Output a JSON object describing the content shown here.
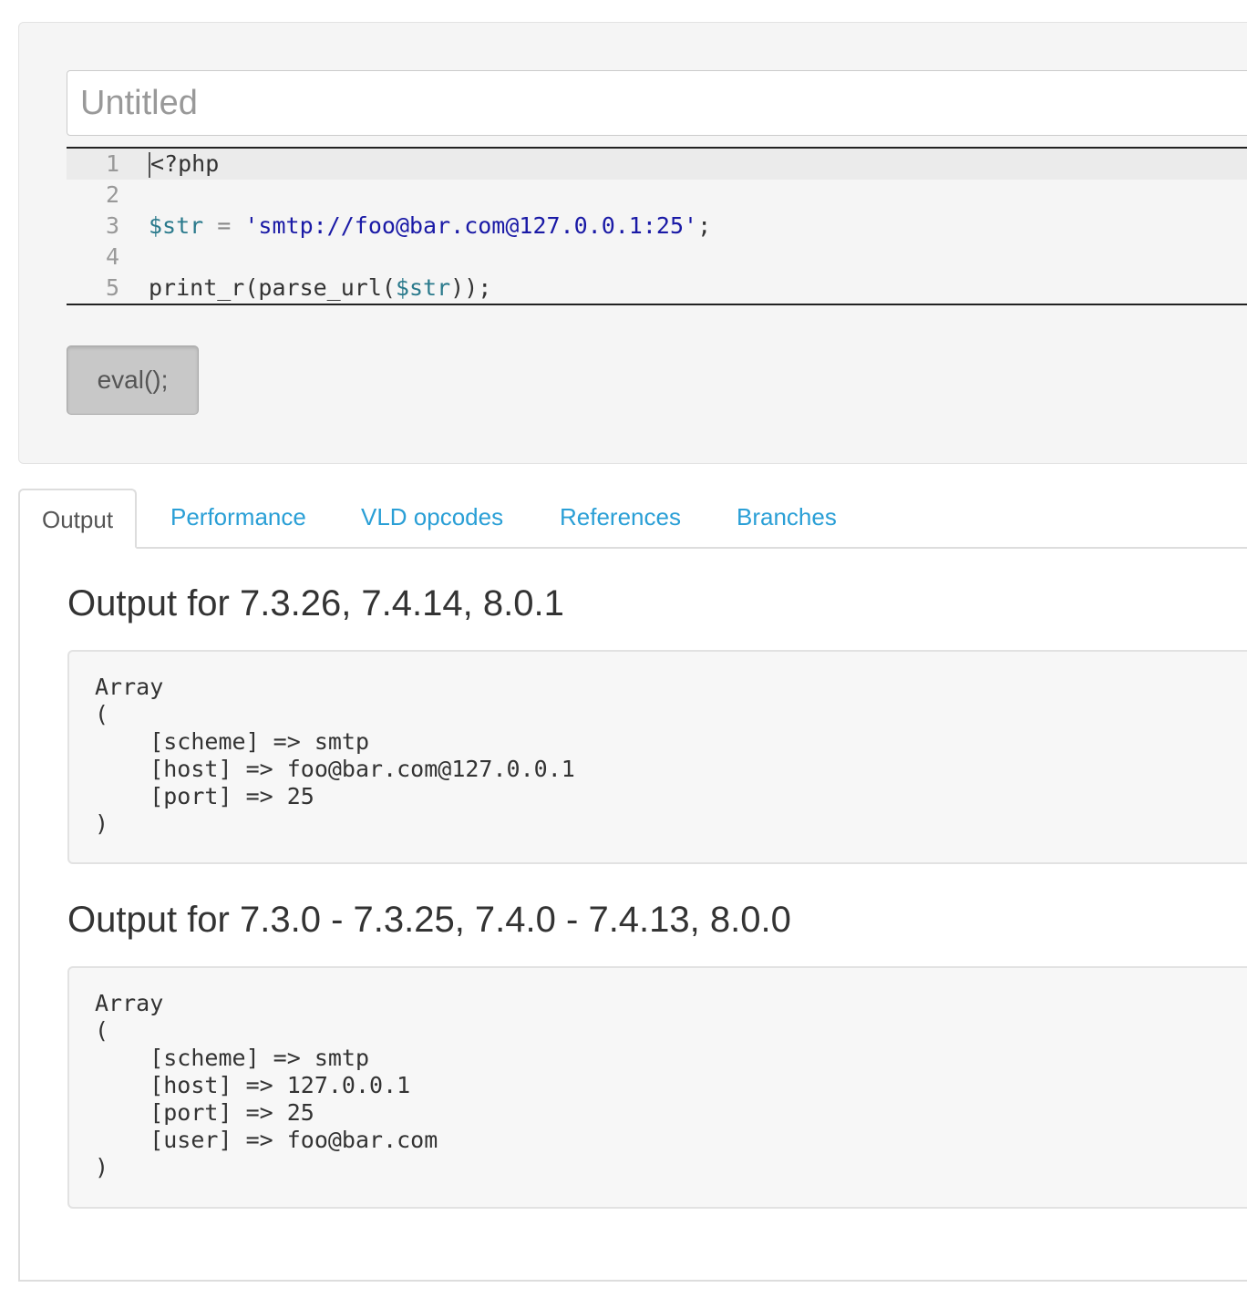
{
  "editor": {
    "title_placeholder": "Untitled",
    "title_value": "",
    "code_lines": [
      {
        "num": "1"
      },
      {
        "num": "2"
      },
      {
        "num": "3"
      },
      {
        "num": "4"
      },
      {
        "num": "5"
      }
    ],
    "code": {
      "line1": "<?php",
      "line3_var": "$str",
      "line3_op": " = ",
      "line3_str": "'smtp://foo@bar.com@127.0.0.1:25'",
      "line3_end": ";",
      "line5_fn": "print_r(parse_url(",
      "line5_var": "$str",
      "line5_end": "));"
    },
    "eval_label": "eval();"
  },
  "tabs": [
    {
      "label": "Output",
      "active": true
    },
    {
      "label": "Performance",
      "active": false
    },
    {
      "label": "VLD opcodes",
      "active": false
    },
    {
      "label": "References",
      "active": false
    },
    {
      "label": "Branches",
      "active": false
    }
  ],
  "outputs": [
    {
      "heading": "Output for 7.3.26, 7.4.14, 8.0.1",
      "text": "Array\n(\n    [scheme] => smtp\n    [host] => foo@bar.com@127.0.0.1\n    [port] => 25\n)"
    },
    {
      "heading": "Output for 7.3.0 - 7.3.25, 7.4.0 - 7.4.13, 8.0.0",
      "text": "Array\n(\n    [scheme] => smtp\n    [host] => 127.0.0.1\n    [port] => 25\n    [user] => foo@bar.com\n)"
    }
  ],
  "colors": {
    "tab_link": "#2a9fd6",
    "code_variable": "#2a7a8c",
    "code_string": "#1a1aa6"
  }
}
